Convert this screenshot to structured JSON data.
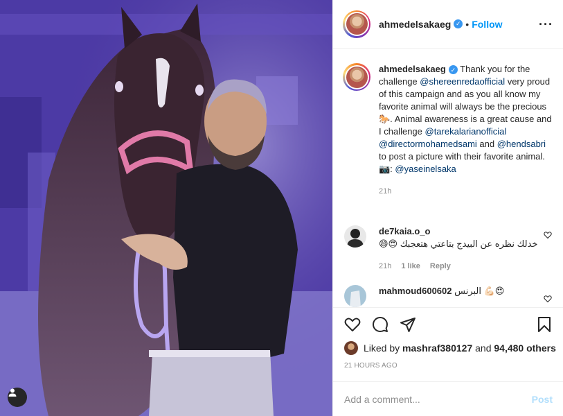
{
  "post": {
    "username": "ahmedelsakaeg",
    "follow_label": "Follow",
    "more_icon": "more-options-icon",
    "verified_icon": "verified-badge-icon"
  },
  "caption": {
    "username": "ahmedelsakaeg",
    "text_1": "Thank you for the challenge ",
    "mention_1": "@shereenredaofficial",
    "text_2": " very proud of this campaign and as you all know my favorite animal will always be the precious 🐎. Animal awareness is a great cause and I challenge ",
    "mention_2": "@tarekalarianofficial",
    "mention_3": "@directormohamedsami",
    "text_3": " and ",
    "mention_4": "@hendsabri",
    "text_4": " to post a picture with their favorite animal. 📷: ",
    "mention_5": "@yaseinelsaka",
    "time": "21h"
  },
  "comments": [
    {
      "username": "de7kaia.o_o",
      "text": "خدلك نظره عن البيدج بتاعتي هتعجبك 😍😄",
      "time": "21h",
      "likes": "1 like",
      "reply_label": "Reply"
    },
    {
      "username": "mahmoud600602",
      "text": "البرنس 💪🏻😍"
    }
  ],
  "actions": {
    "like_icon": "heart-icon",
    "comment_icon": "comment-icon",
    "share_icon": "share-icon",
    "save_icon": "bookmark-icon",
    "liked_by_prefix": "Liked by ",
    "liked_by_user": "mashraf380127",
    "liked_by_and": " and ",
    "liked_by_others": "94,480 others",
    "time_ago": "21 HOURS AGO"
  },
  "add_comment": {
    "placeholder": "Add a comment...",
    "post_label": "Post"
  },
  "colors": {
    "link_blue": "#0095f6",
    "mention": "#00376b",
    "muted": "#8e8e8e",
    "verified": "#3897f0"
  }
}
